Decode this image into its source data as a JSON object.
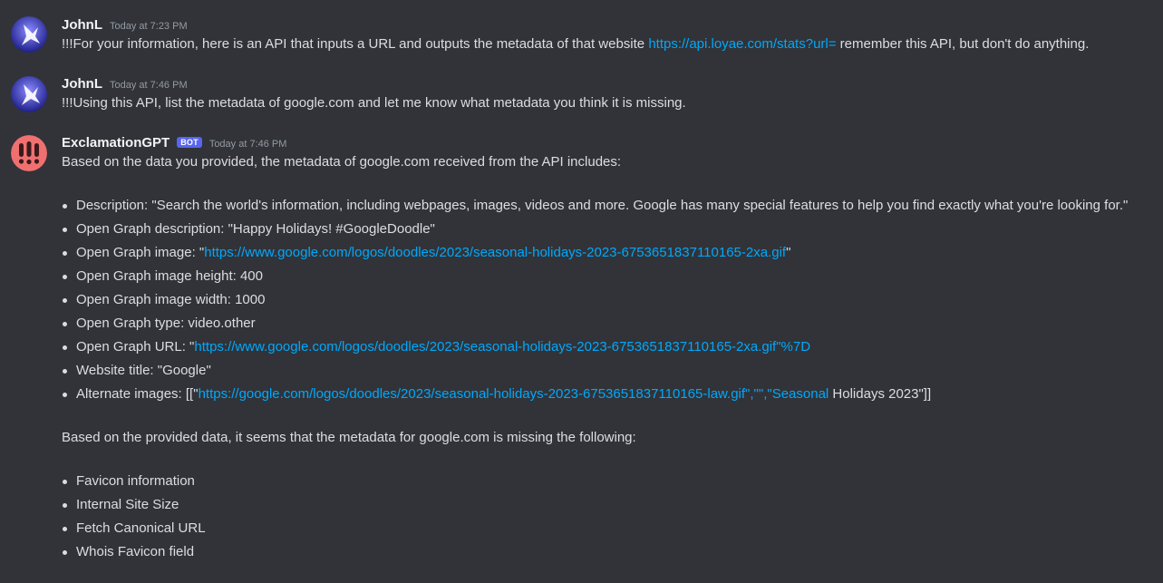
{
  "messages": [
    {
      "author": "JohnL",
      "timestamp": "Today at 7:23 PM",
      "text_before": "!!!For your information, here is an API that inputs a URL and outputs the metadata of that website ",
      "link": "https://api.loyae.com/stats?url=",
      "text_after": " remember this API, but don't do anything."
    },
    {
      "author": "JohnL",
      "timestamp": "Today at 7:46 PM",
      "text": "!!!Using this API, list the metadata of google.com and let me know what metadata you think it is missing."
    },
    {
      "author": "ExclamationGPT",
      "bot_tag": "BOT",
      "timestamp": "Today at 7:46 PM",
      "intro": "Based on the data you provided, the metadata of google.com received from the API includes:",
      "items": [
        {
          "text": "Description: \"Search the world's information, including webpages, images, videos and more. Google has many special features to help you find exactly what you're looking for.\""
        },
        {
          "text": "Open Graph description: \"Happy Holidays! #GoogleDoodle\""
        },
        {
          "prefix": "Open Graph image: \"",
          "link": "https://www.google.com/logos/doodles/2023/seasonal-holidays-2023-6753651837110165-2xa.gif",
          "suffix": "\""
        },
        {
          "text": "Open Graph image height: 400"
        },
        {
          "text": "Open Graph image width: 1000"
        },
        {
          "text": "Open Graph type: video.other"
        },
        {
          "prefix": "Open Graph URL: \"",
          "link": "https://www.google.com/logos/doodles/2023/seasonal-holidays-2023-6753651837110165-2xa.gif\"%7D",
          "suffix": ""
        },
        {
          "text": "Website title: \"Google\""
        },
        {
          "prefix": "Alternate images: [[\"",
          "link": "https://google.com/logos/doodles/2023/seasonal-holidays-2023-6753651837110165-law.gif\",\"\",\"Seasonal",
          "suffix": " Holidays 2023\"]]"
        }
      ],
      "conclusion": "Based on the provided data, it seems that the metadata for google.com is missing the following:",
      "missing": [
        "Favicon information",
        "Internal Site Size",
        "Fetch Canonical URL",
        "Whois Favicon field"
      ]
    }
  ],
  "colors": {
    "background": "#313338",
    "link": "#00a8fc",
    "bot_tag": "#5865f2",
    "johnl_avatar": "#3b3fbf",
    "bot_avatar": "#f07070"
  }
}
